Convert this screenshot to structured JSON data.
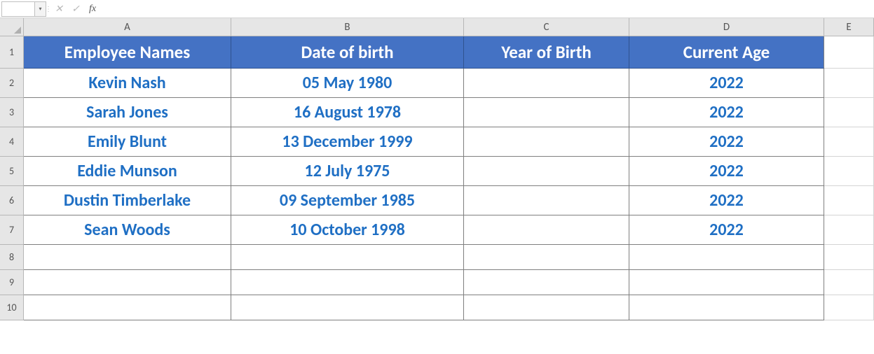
{
  "formula_bar": {
    "name_box": "",
    "fx_value": ""
  },
  "columns": [
    "A",
    "B",
    "C",
    "D",
    "E"
  ],
  "row_numbers": [
    1,
    2,
    3,
    4,
    5,
    6,
    7,
    8,
    9,
    10
  ],
  "headers": {
    "A": "Employee Names",
    "B": "Date of birth",
    "C": "Year of Birth",
    "D": "Current Age"
  },
  "rows": [
    {
      "name": "Kevin Nash",
      "dob": "05 May 1980",
      "yob": "",
      "age": "2022"
    },
    {
      "name": "Sarah Jones",
      "dob": "16 August 1978",
      "yob": "",
      "age": "2022"
    },
    {
      "name": "Emily Blunt",
      "dob": "13 December 1999",
      "yob": "",
      "age": "2022"
    },
    {
      "name": "Eddie Munson",
      "dob": "12 July 1975",
      "yob": "",
      "age": "2022"
    },
    {
      "name": "Dustin Timberlake",
      "dob": "09 September 1985",
      "yob": "",
      "age": "2022"
    },
    {
      "name": "Sean Woods",
      "dob": "10 October 1998",
      "yob": "",
      "age": "2022"
    }
  ]
}
